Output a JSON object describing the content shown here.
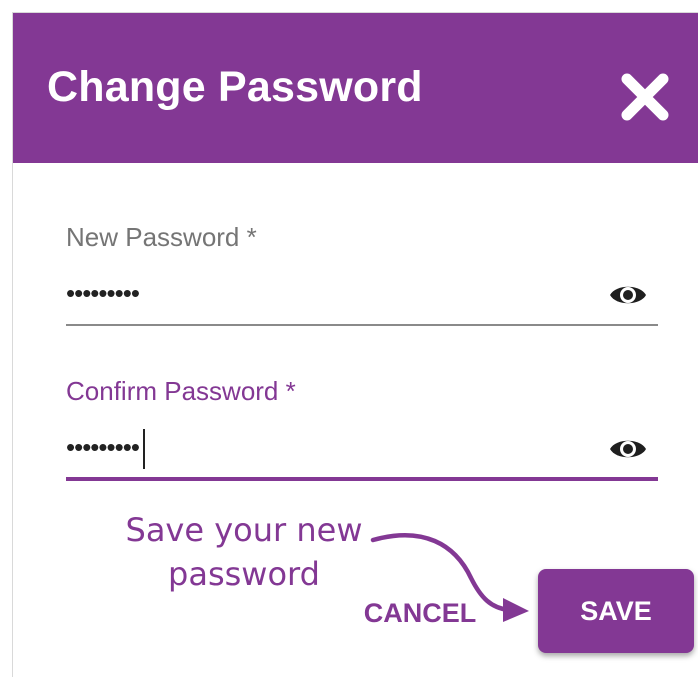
{
  "colors": {
    "brand": "#833894",
    "header_text": "#ffffff",
    "label_inactive": "#757575",
    "underline_inactive": "#8a8a8a"
  },
  "dialog": {
    "title": "Change Password",
    "close_icon": "close-x-icon"
  },
  "fields": {
    "new_password": {
      "label": "New Password *",
      "value": "•••••••••",
      "icon": "eye-icon",
      "focused": false
    },
    "confirm_password": {
      "label": "Confirm Password *",
      "value": "•••••••••",
      "icon": "eye-icon",
      "focused": true
    }
  },
  "annotation": {
    "line1": "Save your new",
    "line2": "password"
  },
  "buttons": {
    "cancel_label": "CANCEL",
    "save_label": "SAVE"
  }
}
